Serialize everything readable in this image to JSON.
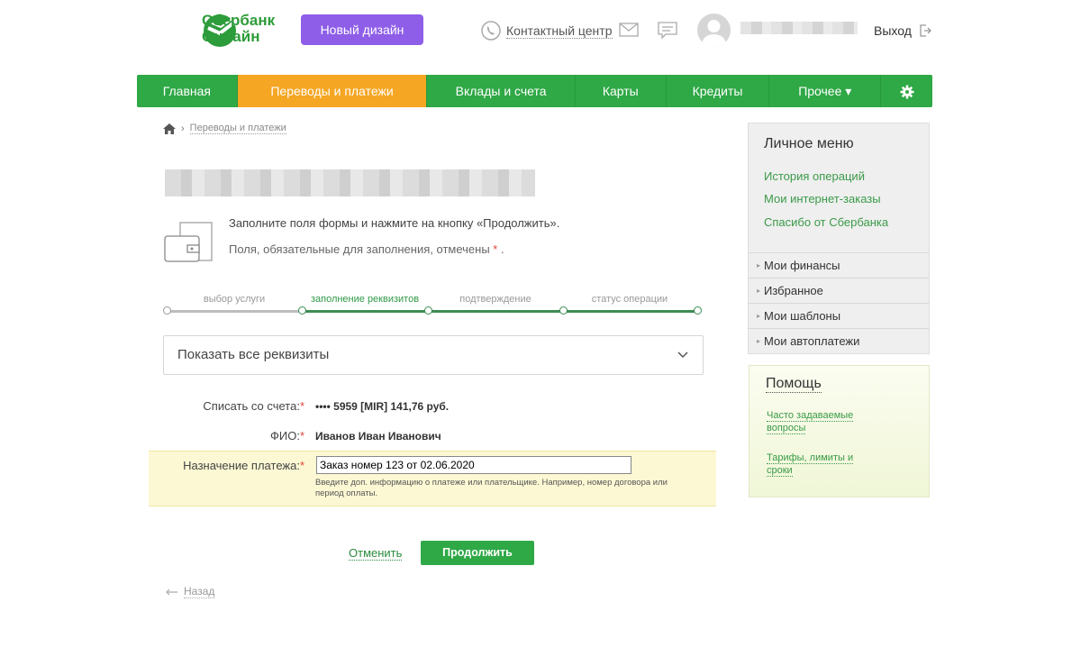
{
  "header": {
    "brand_line1": "Сбербанк",
    "brand_line2": "Онлайн",
    "new_design_label": "Новый дизайн",
    "contact_label": "Контактный центр",
    "logout_label": "Выход"
  },
  "nav": {
    "items": [
      {
        "label": "Главная"
      },
      {
        "label": "Переводы и платежи",
        "active": true
      },
      {
        "label": "Вклады и счета"
      },
      {
        "label": "Карты"
      },
      {
        "label": "Кредиты"
      },
      {
        "label": "Прочее ▾"
      }
    ]
  },
  "breadcrumb": {
    "current": "Переводы и платежи"
  },
  "form": {
    "hint_main": "Заполните поля формы и нажмите на кнопку «Продолжить».",
    "hint_required": "Поля, обязательные для заполнения, отмечены",
    "required_mark": "*",
    "steps": [
      {
        "label": "выбор услуги",
        "state": "done"
      },
      {
        "label": "заполнение реквизитов",
        "state": "active"
      },
      {
        "label": "подтверждение",
        "state": "pending"
      },
      {
        "label": "статус операции",
        "state": "pending"
      }
    ],
    "show_all_label": "Показать все реквизиты",
    "account_label": "Списать со счета:",
    "account_value": "•••• 5959  [MIR] 141,76   руб.",
    "fio_label": "ФИО:",
    "fio_value": "Иванов Иван Иванович",
    "purpose_label": "Назначение платежа:",
    "purpose_value": "Заказ номер 123 от 02.06.2020",
    "purpose_hint": "Введите доп. информацию о платеже или плательщике. Например, номер договора или период оплаты.",
    "cancel_label": "Отменить",
    "continue_label": "Продолжить",
    "back_label": "Назад"
  },
  "side_menu": {
    "title": "Личное меню",
    "links": [
      "История операций",
      "Мои интернет-заказы",
      "Спасибо от Сбербанка"
    ],
    "sections": [
      "Мои финансы",
      "Избранное",
      "Мои шаблоны",
      "Мои автоплатежи"
    ]
  },
  "help": {
    "title": "Помощь",
    "faq_line1": "Часто задаваемые",
    "faq_line2": "вопросы",
    "tariffs_line1": "Тарифы, лимиты и",
    "tariffs_line2": "сроки"
  },
  "colors": {
    "brand_green": "#2fa846",
    "active_tab": "#f5a623",
    "purple_button": "#8e5ee8"
  }
}
